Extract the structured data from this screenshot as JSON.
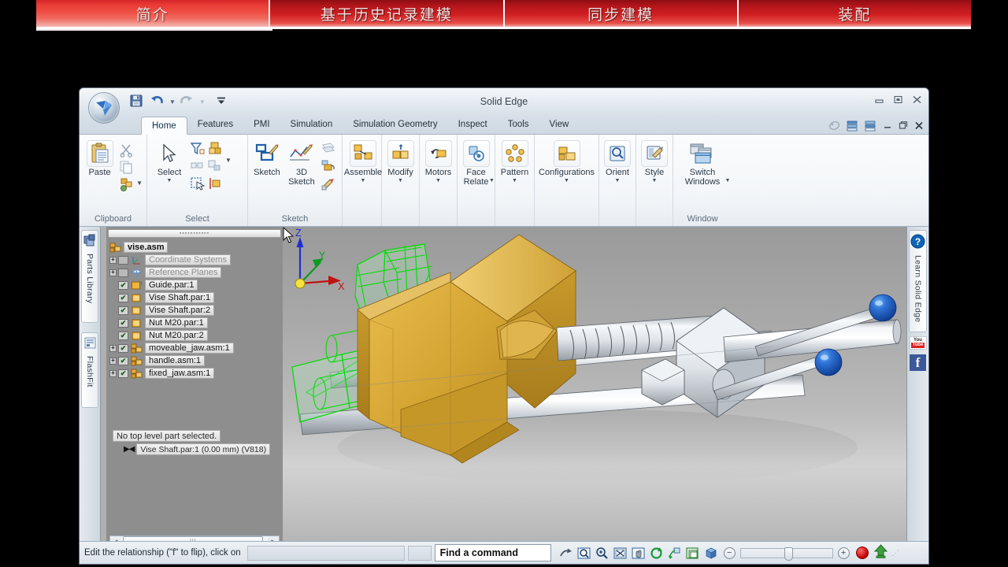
{
  "banner": {
    "tabs": [
      {
        "label": "简介",
        "active": true
      },
      {
        "label": "基于历史记录建模",
        "active": false
      },
      {
        "label": "同步建模",
        "active": false
      },
      {
        "label": "装配",
        "active": false
      }
    ]
  },
  "window": {
    "title": "Solid Edge",
    "min_label": "—",
    "restore_label": "❐",
    "close_label": "✕"
  },
  "quick_access": {
    "save_tip": "Save",
    "undo_tip": "Undo",
    "redo_tip": "Redo",
    "more_tip": "Customize Quick Access Toolbar"
  },
  "ribbon": {
    "tabs": [
      {
        "label": "Home",
        "active": true
      },
      {
        "label": "Features",
        "active": false
      },
      {
        "label": "PMI",
        "active": false
      },
      {
        "label": "Simulation",
        "active": false
      },
      {
        "label": "Simulation Geometry",
        "active": false
      },
      {
        "label": "Inspect",
        "active": false
      },
      {
        "label": "Tools",
        "active": false
      },
      {
        "label": "View",
        "active": false
      }
    ],
    "right_controls": {
      "help_tip": "Help",
      "view1_tip": "Show ribbon",
      "view2_tip": "Hide ribbon",
      "minimize": "—",
      "restore": "❐",
      "close": "✕"
    },
    "groups": [
      {
        "name": "Clipboard",
        "label": "Clipboard",
        "buttons": [
          {
            "label": "Paste",
            "icon": "paste-icon",
            "caret": false
          }
        ],
        "small_icons": [
          "cut-icon",
          "copy-icon",
          "copy-part-icon",
          "dropdown-caret-icon"
        ]
      },
      {
        "name": "Select",
        "label": "Select",
        "buttons": [
          {
            "label": "Select",
            "icon": "arrow-cursor-icon",
            "caret": true
          }
        ],
        "small_icons": [
          "select-filter-icon",
          "select-part-icon",
          "select-window-icon",
          "select-region-icon",
          "dropdown-caret-icon",
          "select-fence-icon",
          "select-edge-icon"
        ]
      },
      {
        "name": "Sketch",
        "label": "Sketch",
        "buttons": [
          {
            "label": "Sketch",
            "icon": "sketch-icon",
            "caret": false
          },
          {
            "label": "3D\nSketch",
            "icon": "3d-sketch-icon",
            "caret": false
          }
        ],
        "small_icons": [
          "plane-icon",
          "sketch-region-icon",
          "pen-icon"
        ]
      },
      {
        "name": "Assemble",
        "label": "",
        "buttons": [
          {
            "label": "Assemble",
            "icon": "assemble-icon",
            "caret": true
          }
        ],
        "small_icons": []
      },
      {
        "name": "Modify",
        "label": "",
        "buttons": [
          {
            "label": "Modify",
            "icon": "modify-icon",
            "caret": true
          }
        ],
        "small_icons": []
      },
      {
        "name": "Motors",
        "label": "",
        "buttons": [
          {
            "label": "Motors",
            "icon": "motors-icon",
            "caret": true
          }
        ],
        "small_icons": []
      },
      {
        "name": "FaceRelate",
        "label": "",
        "buttons": [
          {
            "label": "Face\nRelate",
            "icon": "face-relate-icon",
            "caret": true
          }
        ],
        "small_icons": []
      },
      {
        "name": "Pattern",
        "label": "",
        "buttons": [
          {
            "label": "Pattern",
            "icon": "pattern-icon",
            "caret": true
          }
        ],
        "small_icons": []
      },
      {
        "name": "Configurations",
        "label": "",
        "buttons": [
          {
            "label": "Configurations",
            "icon": "configurations-icon",
            "caret": true
          }
        ],
        "small_icons": []
      },
      {
        "name": "Orient",
        "label": "",
        "buttons": [
          {
            "label": "Orient",
            "icon": "orient-icon",
            "caret": true
          }
        ],
        "small_icons": []
      },
      {
        "name": "Style",
        "label": "",
        "buttons": [
          {
            "label": "Style",
            "icon": "style-icon",
            "caret": true
          }
        ],
        "small_icons": []
      },
      {
        "name": "Window",
        "label": "Window",
        "buttons": [
          {
            "label": "Switch\nWindows",
            "icon": "switch-windows-icon",
            "caret": true
          }
        ],
        "small_icons": []
      }
    ]
  },
  "left_rail": {
    "items": [
      {
        "label": "Parts Library",
        "icon": "parts-library-icon"
      },
      {
        "label": "FlashFit",
        "icon": "flashfit-icon"
      }
    ]
  },
  "right_rail": {
    "learn_label": "Learn Solid Edge",
    "help_icon": "question-mark-icon",
    "youtube": {
      "top": "You",
      "bottom": "Tube"
    },
    "facebook": {
      "glyph": "f"
    }
  },
  "tree": {
    "root": {
      "label": "vise.asm",
      "icon": "assembly-icon"
    },
    "items": [
      {
        "label": "Coordinate Systems",
        "expand": "+",
        "check": "none",
        "icon": "coordinate-system-icon",
        "dim": true
      },
      {
        "label": "Reference Planes",
        "expand": "+",
        "check": "none",
        "icon": "reference-plane-icon",
        "dim": true
      },
      {
        "label": "Guide.par:1",
        "expand": "",
        "check": "checked",
        "icon": "part-open-icon",
        "dim": false
      },
      {
        "label": "Vise Shaft.par:1",
        "expand": "",
        "check": "checked",
        "icon": "part-icon",
        "dim": false
      },
      {
        "label": "Vise Shaft.par:2",
        "expand": "",
        "check": "checked",
        "icon": "part-icon",
        "dim": false
      },
      {
        "label": "Nut M20.par:1",
        "expand": "",
        "check": "checked",
        "icon": "part-icon",
        "dim": false
      },
      {
        "label": "Nut M20.par:2",
        "expand": "",
        "check": "checked",
        "icon": "part-icon",
        "dim": false
      },
      {
        "label": "moveable_jaw.asm:1",
        "expand": "+",
        "check": "checked",
        "icon": "assembly-icon",
        "dim": false
      },
      {
        "label": "handle.asm:1",
        "expand": "+",
        "check": "checked",
        "icon": "assembly-icon",
        "dim": false
      },
      {
        "label": "fixed_jaw.asm:1",
        "expand": "+",
        "check": "checked",
        "icon": "assembly-icon",
        "dim": false
      }
    ],
    "status": {
      "line1": "No top level part selected.",
      "line2": "Vise Shaft.par:1   (0.00 mm)   (V818)"
    },
    "hscroll": {
      "thumb_grip": "III",
      "left_arrow": "◄",
      "right_arrow": "►"
    }
  },
  "viewport": {
    "triad": {
      "z": "Z",
      "y": "Y",
      "x": "X"
    },
    "colors": {
      "selected_wireframe": "#00e000",
      "jaw_gold": "#d5a531",
      "handle_ball": "#1a5fd0",
      "metal": "#d8dde2"
    },
    "cursor": "mouse-pointer"
  },
  "status_bar": {
    "prompt": "Edit the relationship (\"f\" to flip), click on",
    "find_command_value": "Find a command",
    "find_command_placeholder": "Find a command",
    "icons": [
      "redo-arrow-icon",
      "zoom-area-icon",
      "zoom-icon",
      "fit-icon",
      "pan-icon",
      "rotate-icon",
      "look-at-icon",
      "view-styles-icon",
      "shaded-icon"
    ],
    "zoom_out": "−",
    "zoom_in": "+",
    "record_tip": "Record macro",
    "promote_tip": "Promote"
  }
}
